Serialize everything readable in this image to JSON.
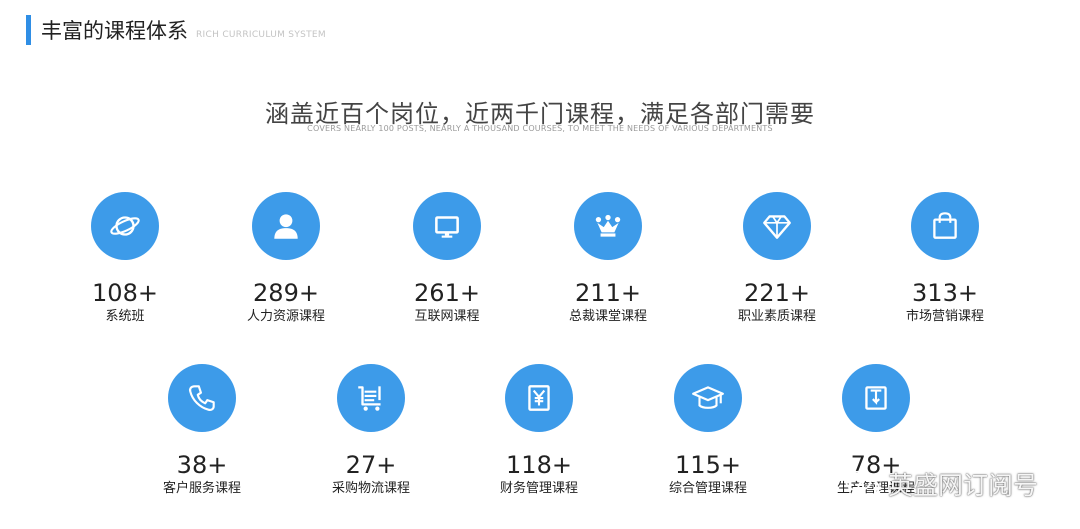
{
  "section": {
    "title": "丰富的课程体系",
    "subtitle": "RICH CURRICULUM SYSTEM"
  },
  "headline": "涵盖近百个岗位，近两千门课程，满足各部门需要",
  "sub_headline": "COVERS NEARLY 100 POSTS, NEARLY A THOUSAND COURSES, TO MEET THE NEEDS OF VARIOUS DEPARTMENTS",
  "accent_color": "#3d9be9",
  "courses": [
    {
      "count": "108+",
      "label": "系统班",
      "icon": "planet-icon"
    },
    {
      "count": "289+",
      "label": "人力资源课程",
      "icon": "user-icon"
    },
    {
      "count": "261+",
      "label": "互联网课程",
      "icon": "monitor-icon"
    },
    {
      "count": "211+",
      "label": "总裁课堂课程",
      "icon": "crown-icon"
    },
    {
      "count": "221+",
      "label": "职业素质课程",
      "icon": "diamond-icon"
    },
    {
      "count": "313+",
      "label": "市场营销课程",
      "icon": "shopping-bag-icon"
    },
    {
      "count": "38+",
      "label": "客户服务课程",
      "icon": "phone-icon"
    },
    {
      "count": "27+",
      "label": "采购物流课程",
      "icon": "shopping-cart-icon"
    },
    {
      "count": "118+",
      "label": "财务管理课程",
      "icon": "yen-icon"
    },
    {
      "count": "115+",
      "label": "综合管理课程",
      "icon": "graduation-cap-icon"
    },
    {
      "count": "78+",
      "label": "生产管理课程",
      "icon": "book-icon"
    }
  ],
  "watermark": {
    "text": "英盛网订阅号",
    "icon": "wechat-icon"
  }
}
